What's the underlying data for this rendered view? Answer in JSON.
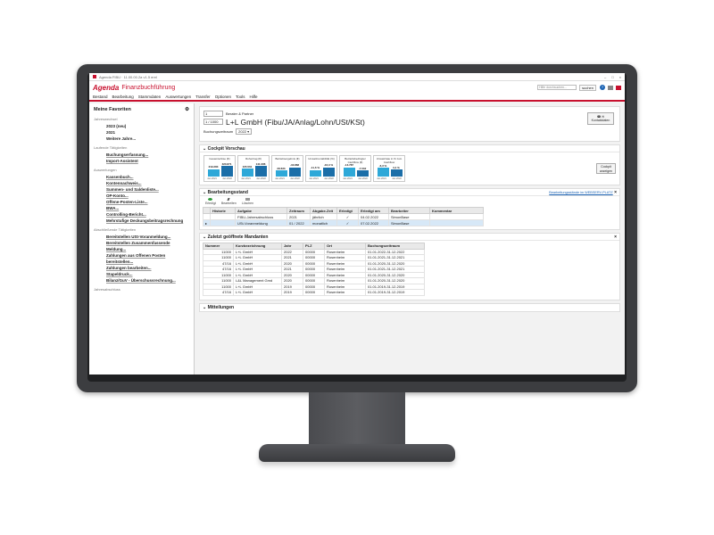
{
  "window": {
    "title": "Agenda FIBU · 11.00.00.2a v1.5 erel",
    "controls": [
      "–",
      "□",
      "×"
    ]
  },
  "app": {
    "brand": "Agenda",
    "module": "Finanzbuchführung",
    "search_placeholder": "Hilfe durchsuchen...",
    "search_button": "suchen",
    "help": "?"
  },
  "menu": [
    "Bestand",
    "Bearbeitung",
    "Stammdaten",
    "Auswertungen",
    "Transfer",
    "Optionen",
    "Tools",
    "Hilfe"
  ],
  "sidebar": {
    "title": "Meine Favoriten",
    "groups": [
      {
        "label": "Jahreswechsel",
        "items": [
          "2023 (neu)",
          "2021",
          "Weitere Jahre..."
        ]
      },
      {
        "label": "Laufende Tätigkeiten",
        "items": [
          "Buchungserfassung...",
          "Import-Assistent"
        ]
      },
      {
        "label": "Auswertungen",
        "items": [
          "Kassenbuch...",
          "Kontennachweis...",
          "Summen- und Saldenliste...",
          "OP-Konto...",
          "Offene-Posten-Liste...",
          "BWA...",
          "Controlling-Bericht...",
          "Mehrstufige Deckungsbeitragsrechnung"
        ]
      },
      {
        "label": "Abschließende Tätigkeiten",
        "items": [
          "Bereitstellen USt-Voranmeldung...",
          "Bereitstellen Zusammenfassende Meldung...",
          "Zahlungen aus Offenen Posten bereitstellen...",
          "Zahlungen bearbeiten...",
          "Stapeldruck..."
        ]
      },
      {
        "label": "",
        "items": [
          "Bilanz/GuV - Überschussrechnung..."
        ]
      },
      {
        "label": "Jahresabschluss",
        "items": []
      }
    ]
  },
  "client": {
    "number_1": "1",
    "label_1": "Berater & Partner",
    "number_2": "1 / 1000",
    "name": "L+L GmbH (Fibu/JA/Anlag/Lohn/USt/KSt)",
    "period_label": "Buchungszeitraum",
    "period_value": "2022 ▾",
    "contact_button": "Kontaktdaten"
  },
  "cockpit": {
    "title": "Cockpit Vorschau",
    "button": "Cockpit anzeigen",
    "kpis": [
      {
        "title": "Gesamterlöse (€)",
        "v1": "219.283",
        "v2": "320.871",
        "f1": 0.68,
        "f2": 1.0,
        "y1": "Jan 2021",
        "y2": "Jan 2022"
      },
      {
        "title": "Rohertrag (€)",
        "v1": "105.561",
        "v2": "141.086",
        "f1": 0.75,
        "f2": 1.0,
        "y1": "Jan 2021",
        "y2": "Jan 2022"
      },
      {
        "title": "Betriebsergebnis (€)",
        "v1": "28.633",
        "v2": "-43.868",
        "f1": 0.55,
        "f2": 0.85,
        "y1": "Jan 2021",
        "y2": "Jan 2022"
      },
      {
        "title": "Umsatzrentabilität (%)",
        "v1": "-11,6 %",
        "v2": "-16,3 %",
        "f1": 0.6,
        "f2": 0.85,
        "y1": "Jan 2021",
        "y2": "Jan 2022"
      },
      {
        "title": "Betriebsbedingter Cashflow (€)",
        "v1": "-13.787",
        "v2": "-7.032",
        "f1": 0.85,
        "f2": 0.55,
        "y1": "Jan 2021",
        "y2": "Jan 2022"
      },
      {
        "title": "Umsatzrate in % zum Cashflow",
        "v1": "-6,3 %",
        "v2": "3,4 %",
        "f1": 0.8,
        "f2": 0.65,
        "y1": "Jan 2021",
        "y2": "Jan 2022"
      }
    ]
  },
  "status": {
    "title": "Bearbeitungsstand",
    "link": "Bearbeitungsstände im WEBSERV-PLATZ",
    "tools": [
      "Erledigt",
      "Bearbeiten",
      "Löschen"
    ],
    "headers": [
      "",
      "Historie",
      "Aufgabe",
      "Zeitraum",
      "Abgabe-Zeit",
      "Erledigt",
      "Erledigt am",
      "Bearbeiter",
      "Kommentar"
    ],
    "rows": [
      [
        "",
        "",
        "FIBU-Jahresabschluss",
        "2021",
        "jährlich",
        "✓",
        "04.02.2022",
        "SimonBase",
        ""
      ],
      [
        "▸",
        "",
        "USt-Voranmeldung",
        "01 / 2022",
        "monatlich",
        "✓",
        "07.02.2022",
        "SimonBase",
        ""
      ]
    ]
  },
  "mandanten": {
    "title": "Zuletzt geöffnete Mandanten",
    "headers": [
      "Nummer",
      "Kurzbezeichnung",
      "Jahr",
      "PLZ",
      "Ort",
      "Buchungszeitraum"
    ],
    "rows": [
      [
        "11000",
        "L+L GmbH",
        "2022",
        "00000",
        "Rosenheim",
        "01.01.2022-31.12.2022"
      ],
      [
        "11000",
        "L+L GmbH",
        "2021",
        "00000",
        "Rosenheim",
        "01.01.2021-31.12.2021"
      ],
      [
        "47/16",
        "L+L GmbH",
        "2020",
        "00000",
        "Rosenheim",
        "01.01.2020-31.12.2020"
      ],
      [
        "47/16",
        "L+L GmbH",
        "2021",
        "00000",
        "Rosenheim",
        "01.01.2021-31.12.2021"
      ],
      [
        "11000",
        "L+L GmbH",
        "2020",
        "00000",
        "Rosenheim",
        "01.01.2020-31.12.2020"
      ],
      [
        "11000",
        "L&L Management Gmd",
        "2020",
        "00000",
        "Rosenheim",
        "01.01.2020-31.12.2020"
      ],
      [
        "11000",
        "L+L GmbH",
        "2019",
        "00000",
        "Rosenheim",
        "01.01.2019-31.12.2019"
      ],
      [
        "47/16",
        "L+L GmbH",
        "2019",
        "00000",
        "Rosenheim",
        "01.01.2019-31.12.2019"
      ]
    ]
  },
  "mitteilungen": {
    "title": "Mitteilungen"
  },
  "colors": {
    "brand": "#c8102e",
    "accent": "#2ea8d8",
    "accent_dark": "#1b6ea8",
    "selection": "#d7e8f7"
  }
}
